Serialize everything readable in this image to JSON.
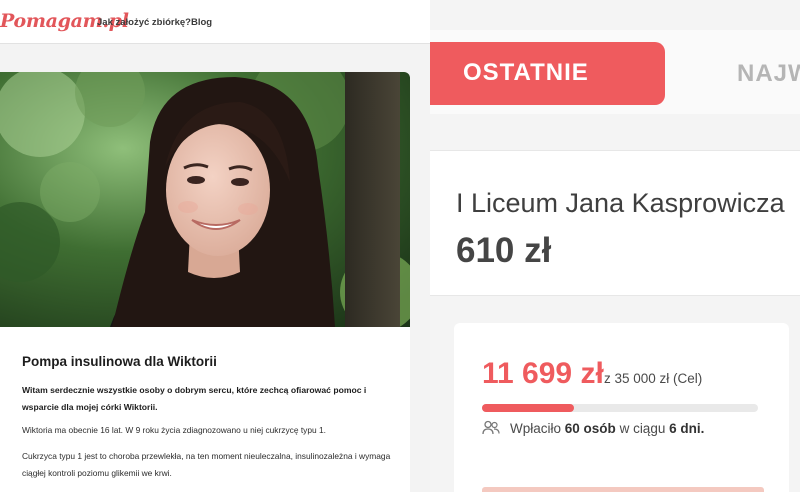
{
  "site": {
    "logo": "Pomagam.pl",
    "nav": [
      "Jak założyć zbiórkę?",
      "Blog"
    ]
  },
  "article": {
    "image_alt": "Zdjęcie uśmiechniętej dziewczyny o ciemnych włosach",
    "title": "Pompa insulinowa dla Wiktorii",
    "intro": "Witam serdecznie wszystkie osoby o dobrym sercu, które zechcą ofiarować pomoc i wsparcie dla mojej córki Wiktorii.",
    "paragraph_1": "Wiktoria ma obecnie 16 lat. W 9 roku życia zdiagnozowano u niej cukrzycę typu 1.",
    "paragraph_2": "Cukrzyca typu 1 jest to choroba przewlekła, na ten moment nieuleczalna, insulinozależna i wymaga ciągłej kontroli poziomu glikemii we krwi."
  },
  "donations": {
    "tabs": [
      {
        "label": "OSTATNIE",
        "active": true
      },
      {
        "label": "NAJW",
        "active": false
      }
    ],
    "latest": {
      "donor": "I Liceum Jana Kasprowicza",
      "amount": "610 zł"
    }
  },
  "fundraiser": {
    "raised": "11 699 zł",
    "goal_label": "z 35 000 zł (Cel)",
    "progress": 0.334,
    "paid_prefix": "Wpłaciło",
    "paid_count": "60 osób",
    "paid_middle": "w ciągu",
    "paid_days": "6 dni.",
    "people_icon": "people-icon"
  },
  "colors": {
    "brand": "#ef5b5e",
    "text_dark": "#3f3f3f",
    "progress_track": "#e9e9e9"
  }
}
